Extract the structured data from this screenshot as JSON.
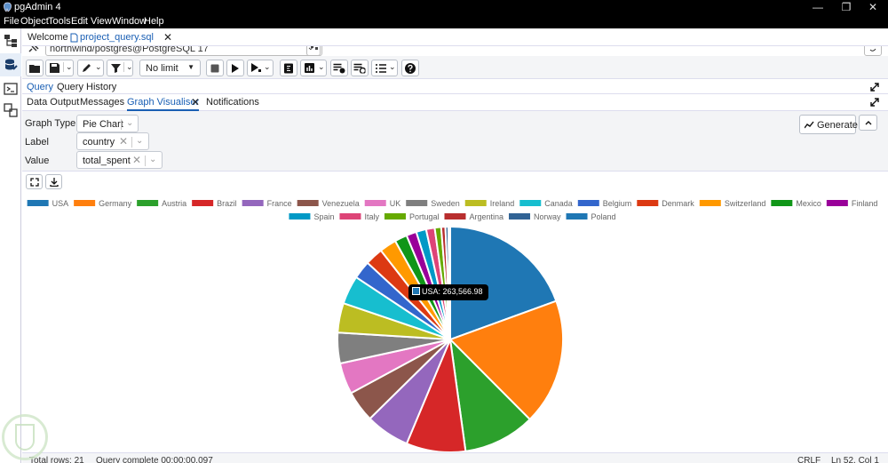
{
  "window": {
    "title": "pgAdmin 4",
    "controls": [
      "—",
      "❐",
      "✕"
    ]
  },
  "menu": [
    "File",
    "Object",
    "Tools",
    "Edit",
    "View",
    "Window",
    "Help"
  ],
  "top_tabs": [
    {
      "label": "Welcome",
      "active": false
    },
    {
      "label": "project_query.sql",
      "active": true
    }
  ],
  "connection": {
    "value": "northwind/postgres@PostgreSQL 17"
  },
  "toolbar": {
    "limit_label": "No limit"
  },
  "query_tabs": [
    "Query",
    "Query History"
  ],
  "result_tabs": [
    {
      "label": "Data Output",
      "active": false
    },
    {
      "label": "Messages",
      "active": false
    },
    {
      "label": "Graph Visualiser",
      "active": true
    },
    {
      "label": "Notifications",
      "active": false
    }
  ],
  "graph_form": {
    "graph_type_label": "Graph Type",
    "graph_type_value": "Pie Chart",
    "label_label": "Label",
    "label_value": "country",
    "value_label": "Value",
    "value_value": "total_spent",
    "generate_label": "Generate"
  },
  "tooltip": {
    "text": "USA: 263,566.98",
    "color": "#1f77b4"
  },
  "chart_data": {
    "type": "pie",
    "legend_position": "top",
    "categories": [
      "USA",
      "Germany",
      "Austria",
      "Brazil",
      "France",
      "Venezuela",
      "UK",
      "Sweden",
      "Ireland",
      "Canada",
      "Belgium",
      "Denmark",
      "Switzerland",
      "Mexico",
      "Finland",
      "Spain",
      "Italy",
      "Portugal",
      "Argentina",
      "Norway",
      "Poland"
    ],
    "values": [
      263566.98,
      244640.63,
      139496.63,
      114968.48,
      85498.76,
      60814.89,
      60616.51,
      59523.7,
      57317.39,
      55334.1,
      35134.98,
      34782.25,
      32919.5,
      24073.45,
      19778.45,
      19431.89,
      16705.15,
      12468.65,
      8119.1,
      5735.15,
      3531.95
    ],
    "colors": [
      "#1f77b4",
      "#ff7f0e",
      "#2ca02c",
      "#d62728",
      "#9467bd",
      "#8c564b",
      "#e377c2",
      "#7f7f7f",
      "#bcbd22",
      "#17becf",
      "#3366cc",
      "#dc3912",
      "#ff9900",
      "#109618",
      "#990099",
      "#0099c6",
      "#dd4477",
      "#66aa00",
      "#b82e2e",
      "#316395",
      "#1f77b4"
    ]
  },
  "status": {
    "rows": "Total rows: 21",
    "query": "Query complete 00:00:00.097",
    "eol": "CRLF",
    "position": "Ln 52, Col 1"
  }
}
